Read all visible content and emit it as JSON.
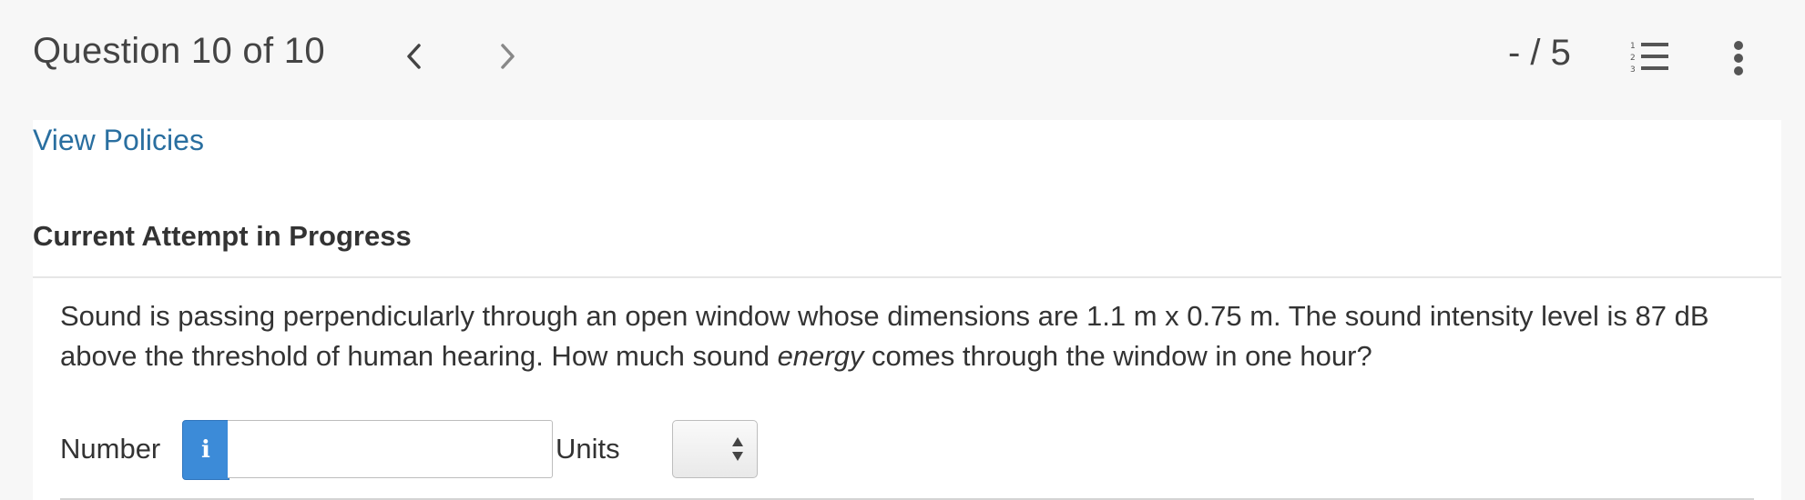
{
  "header": {
    "question_title": "Question 10 of 10",
    "score": "- / 5"
  },
  "links": {
    "view_policies": "View Policies"
  },
  "attempt": {
    "heading": "Current Attempt in Progress"
  },
  "question": {
    "text_before": "Sound is passing perpendicularly through an open window whose dimensions are 1.1 m x 0.75 m. The sound intensity level is 87 dB above the threshold of human hearing. How much sound ",
    "emphasis": "energy",
    "text_after": " comes through the window in one hour?"
  },
  "answer": {
    "number_label": "Number",
    "info_icon": "i",
    "number_value": "",
    "units_label": "Units",
    "units_selected": ""
  },
  "icons": {
    "prev": "chevron-left-icon",
    "next": "chevron-right-icon",
    "list": "numbered-list-icon",
    "more": "vertical-dots-icon",
    "info": "info-icon"
  },
  "colors": {
    "link": "#2a6fa0",
    "info_button": "#3c8bd8",
    "header_bg": "#f7f7f7"
  }
}
